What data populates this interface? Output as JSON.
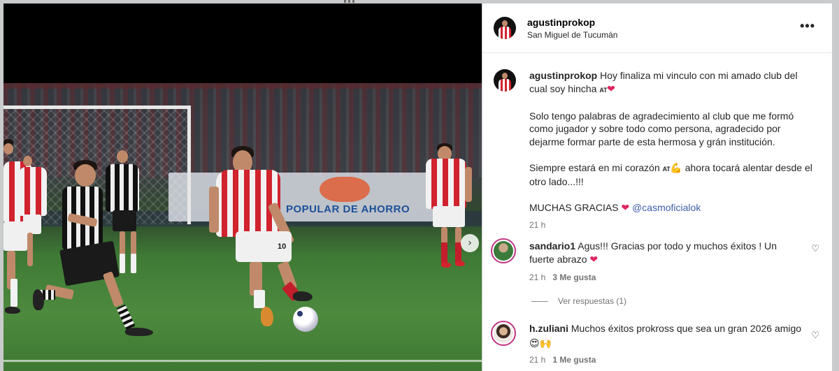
{
  "post": {
    "author": "agustinprokop",
    "location": "San Miguel de Tucumán",
    "more_label": "•••",
    "next_label": "›",
    "banner_text": "POPULAR DE AHORRO",
    "jersey_number": "10",
    "caption": {
      "username": "agustinprokop",
      "line1": "Hoy finaliza mi vinculo con mi amado club del cual soy hincha",
      "line1_badge": "AT",
      "line1_emoji": "❤",
      "para2": "Solo tengo palabras de agradecimiento al club que me formó como jugador y sobre todo como persona, agradecido por dejarme formar parte de esta hermosa y grán institución.",
      "para3_start": "Siempre estará en mi corazón",
      "para3_badge": "AT",
      "para3_emoji": "💪",
      "para3_end": "ahora tocará alentar desde el otro lado...!!!",
      "para4": "MUCHAS GRACIAS",
      "para4_emoji": "❤",
      "mention": "@casmoficialok",
      "time": "21 h"
    }
  },
  "comments": [
    {
      "username": "sandario1",
      "text": "Agus!!! Gracias por todo y muchos éxitos ! Un fuerte abrazo",
      "emoji": "❤",
      "time": "21 h",
      "likes": "3 Me gusta",
      "like_icon": "heart-outline-icon",
      "avatar_color": "#3a7a3a"
    },
    {
      "username": "h.zuliani",
      "text": "Muchos éxitos prokross que sea un gran 2026 amigo",
      "emoji": "😍🙌",
      "time": "21 h",
      "likes": "1 Me gusta",
      "like_icon": "heart-outline-icon",
      "avatar_color": "#a07a5a"
    }
  ],
  "replies_label": "Ver respuestas (1)",
  "colors": {
    "mention": "#3c5dad",
    "heart": "#e0245e",
    "home_stripe_red": "#d0232e",
    "story_ring": "#c13584"
  }
}
